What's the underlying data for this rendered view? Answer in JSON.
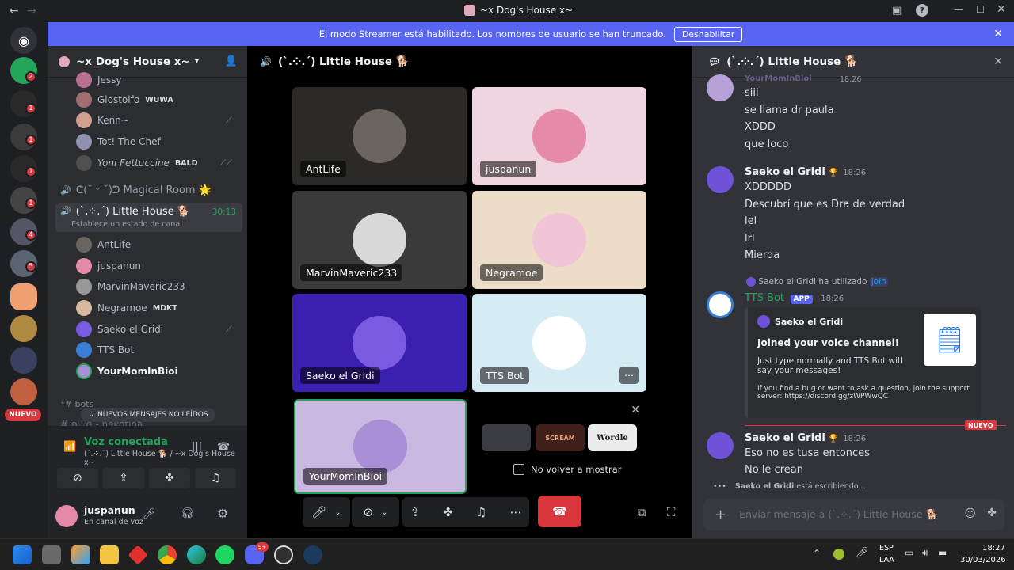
{
  "window": {
    "title": "~x Dog's House x~"
  },
  "banner": {
    "text": "El modo Streamer está habilitado. Los nombres de usuario se han truncado.",
    "button": "Deshabilitar"
  },
  "rail": {
    "badges": [
      "2",
      "1",
      "1",
      "1",
      "1",
      "4",
      "5"
    ],
    "nuevo": "NUEVO"
  },
  "server": {
    "name": "~x Dog's House x~"
  },
  "sidebar": {
    "top_members": [
      {
        "name": "Jessy",
        "tag": ""
      },
      {
        "name": "Giostolfo",
        "tag": "WUWA"
      },
      {
        "name": "Kenn~",
        "tag": ""
      },
      {
        "name": "Tot! The Chef",
        "tag": ""
      },
      {
        "name": "Yoni Fettuccine",
        "tag": "BALD"
      }
    ],
    "magical_room": "ᕦ(˘ ᵕ ˘)ᕤ Magical Room 🌟",
    "little_house": {
      "name": "(`.⁘.´) Little House 🐕",
      "timer": "30:13",
      "status": "Establece un estado de canal"
    },
    "voice_members": [
      {
        "name": "AntLife",
        "tag": ""
      },
      {
        "name": "juspanun",
        "tag": ""
      },
      {
        "name": "MarvinMaveric233",
        "tag": ""
      },
      {
        "name": "Negramoe",
        "tag": "MDKT"
      },
      {
        "name": "Saeko el Gridi",
        "tag": ""
      },
      {
        "name": "TTS Bot",
        "tag": ""
      },
      {
        "name": "YourMomInBioi",
        "tag": ""
      }
    ],
    "bots_channel": "bots",
    "hidden_channel": "ʚ♡ɞ - nekotina",
    "new_messages": "NUEVOS MENSAJES NO LEÍDOS"
  },
  "voice_panel": {
    "title": "Voz conectada",
    "subtitle": "(`.⁘.´) Little House 🐕 / ~x Dog's House x~"
  },
  "user": {
    "name": "juspanun",
    "status": "En canal de voz"
  },
  "stage": {
    "channel": "(`.⁘.´) Little House 🐕",
    "tiles": [
      {
        "label": "AntLife",
        "color": "#2c2a28",
        "avatar": "#6b6560"
      },
      {
        "label": "juspanun",
        "color": "#f0d4df",
        "avatar": "#e58aa8"
      },
      {
        "label": "MarvinMaveric233",
        "color": "#3a3a3a",
        "avatar": "#d8d8d8"
      },
      {
        "label": "Negramoe",
        "color": "#ecdcc8",
        "avatar": "#f1c3d6"
      },
      {
        "label": "Saeko el Gridi",
        "color": "#3a1fb0",
        "avatar": "#7a5ae0"
      },
      {
        "label": "TTS Bot",
        "color": "#d6ecf5",
        "avatar": "#ffffff"
      },
      {
        "label": "YourMomInBioi",
        "color": "#c9b8e0",
        "avatar": "#a98fd6"
      }
    ],
    "activities": [
      "",
      "SCREAM",
      "Wordle"
    ],
    "no_show": "No volver a mostrar"
  },
  "chat": {
    "channel": "(`.⁘.´) Little House 🐕",
    "first_author": "YourMomInBioi",
    "first_time": "18:26",
    "first_lines": [
      "siii",
      "se llama dr paula",
      "XDDD",
      "que loco"
    ],
    "group2": {
      "author": "Saeko el Gridi",
      "time": "18:26",
      "lines": [
        "XDDDDD",
        "Descubrí que es Dra de verdad",
        "lel",
        "lrl",
        "Mierda"
      ]
    },
    "used": {
      "author": "Saeko el Gridi",
      "text": "ha utilizado",
      "cmd": "join"
    },
    "bot": {
      "name": "TTS Bot",
      "tag": "APP",
      "time": "18:26"
    },
    "embed": {
      "author": "Saeko el Gridi",
      "title": "Joined your voice channel!",
      "body": "Just type normally and TTS Bot will say your messages!",
      "footer": "If you find a bug or want to ask a question, join the support server: https://discord.gg/zWPWwQC"
    },
    "nuevo": "NUEVO",
    "group3": {
      "author": "Saeko el Gridi",
      "time": "18:26",
      "lines": [
        "Eso no es tusa entonces",
        "No le crean"
      ]
    },
    "typing": {
      "author": "Saeko el Gridi",
      "text": "está escribiendo..."
    },
    "input_placeholder": "Enviar mensaje a (`.⁘.´) Little House 🐕"
  },
  "taskbar": {
    "lang": "ESP",
    "layout": "LAA",
    "time": "18:27",
    "date": "30/03/2026",
    "discord_badge": "9+"
  }
}
